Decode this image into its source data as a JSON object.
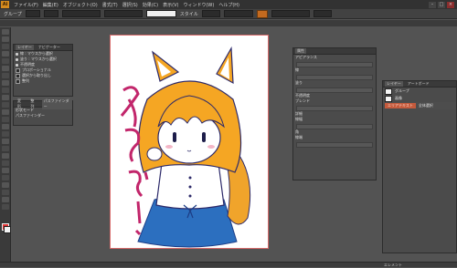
{
  "app": {
    "logo_text": "Ai"
  },
  "menu": [
    "ファイル(F)",
    "編集(E)",
    "オブジェクト(O)",
    "書式(T)",
    "選択(S)",
    "効果(C)",
    "表示(V)",
    "ウィンドウ(W)",
    "ヘルプ(H)"
  ],
  "window_controls": {
    "minimize": "–",
    "maximize": "□",
    "close": "×"
  },
  "control_bar": {
    "selection_label": "グループ",
    "style_label": "スタイル",
    "opacity_value": ""
  },
  "appearance_panel": {
    "tabs": [
      "レイヤー",
      "ナビゲーター"
    ],
    "rows": [
      "線 : マウスから選択",
      "塗り : マウスから選択",
      "不透明度",
      "プロポーショナル",
      "選択から取り出し",
      "整列"
    ]
  },
  "pathfinder_panel": {
    "tabs": [
      "変形",
      "整列",
      "パスファインダー"
    ],
    "rows": [
      "形状モード",
      "パスファインダー"
    ]
  },
  "properties_panel": {
    "tab": "属性",
    "rows": [
      "アピアランス",
      "線",
      "塗り",
      "不透明度",
      "ブレンド",
      "詳細",
      "線幅",
      "角",
      "線端"
    ]
  },
  "layers_panel": {
    "tabs": [
      "レイヤー",
      "アートボード"
    ],
    "items": [
      "グループ",
      "画像"
    ],
    "selected_label": "エリアテキスト",
    "selected_value": "全体選択"
  },
  "status": {
    "text": "エレメント"
  },
  "colors": {
    "accent": "#c46a1f",
    "fill": "#dd3333",
    "stroke": "#f2f2f2"
  }
}
